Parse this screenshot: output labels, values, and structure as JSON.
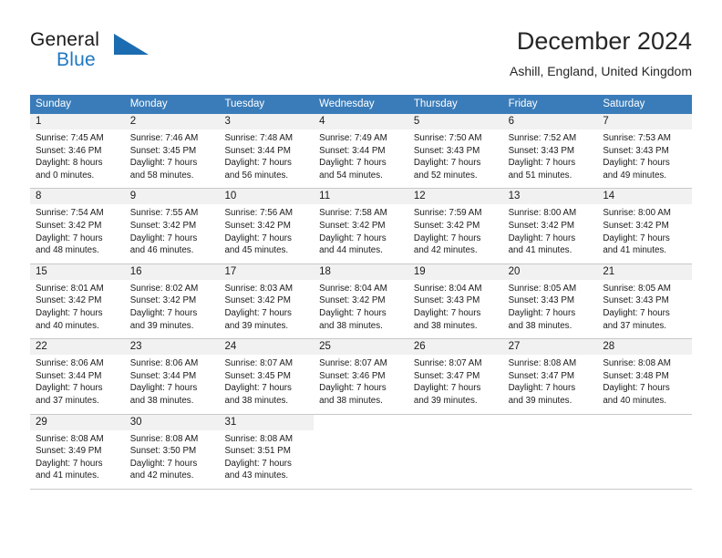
{
  "brand": {
    "name_part1": "General",
    "name_part2": "Blue",
    "mark_icon": "blue-triangle-flag-icon",
    "accent_color": "#1f78c1"
  },
  "header": {
    "title": "December 2024",
    "subtitle": "Ashill, England, United Kingdom"
  },
  "calendar": {
    "header_bg": "#3a7cb9",
    "daynum_bg": "#f1f1f1",
    "weekdays": [
      "Sunday",
      "Monday",
      "Tuesday",
      "Wednesday",
      "Thursday",
      "Friday",
      "Saturday"
    ],
    "weeks": [
      [
        {
          "day": "1",
          "sunrise": "Sunrise: 7:45 AM",
          "sunset": "Sunset: 3:46 PM",
          "daylight_line1": "Daylight: 8 hours",
          "daylight_line2": "and 0 minutes."
        },
        {
          "day": "2",
          "sunrise": "Sunrise: 7:46 AM",
          "sunset": "Sunset: 3:45 PM",
          "daylight_line1": "Daylight: 7 hours",
          "daylight_line2": "and 58 minutes."
        },
        {
          "day": "3",
          "sunrise": "Sunrise: 7:48 AM",
          "sunset": "Sunset: 3:44 PM",
          "daylight_line1": "Daylight: 7 hours",
          "daylight_line2": "and 56 minutes."
        },
        {
          "day": "4",
          "sunrise": "Sunrise: 7:49 AM",
          "sunset": "Sunset: 3:44 PM",
          "daylight_line1": "Daylight: 7 hours",
          "daylight_line2": "and 54 minutes."
        },
        {
          "day": "5",
          "sunrise": "Sunrise: 7:50 AM",
          "sunset": "Sunset: 3:43 PM",
          "daylight_line1": "Daylight: 7 hours",
          "daylight_line2": "and 52 minutes."
        },
        {
          "day": "6",
          "sunrise": "Sunrise: 7:52 AM",
          "sunset": "Sunset: 3:43 PM",
          "daylight_line1": "Daylight: 7 hours",
          "daylight_line2": "and 51 minutes."
        },
        {
          "day": "7",
          "sunrise": "Sunrise: 7:53 AM",
          "sunset": "Sunset: 3:43 PM",
          "daylight_line1": "Daylight: 7 hours",
          "daylight_line2": "and 49 minutes."
        }
      ],
      [
        {
          "day": "8",
          "sunrise": "Sunrise: 7:54 AM",
          "sunset": "Sunset: 3:42 PM",
          "daylight_line1": "Daylight: 7 hours",
          "daylight_line2": "and 48 minutes."
        },
        {
          "day": "9",
          "sunrise": "Sunrise: 7:55 AM",
          "sunset": "Sunset: 3:42 PM",
          "daylight_line1": "Daylight: 7 hours",
          "daylight_line2": "and 46 minutes."
        },
        {
          "day": "10",
          "sunrise": "Sunrise: 7:56 AM",
          "sunset": "Sunset: 3:42 PM",
          "daylight_line1": "Daylight: 7 hours",
          "daylight_line2": "and 45 minutes."
        },
        {
          "day": "11",
          "sunrise": "Sunrise: 7:58 AM",
          "sunset": "Sunset: 3:42 PM",
          "daylight_line1": "Daylight: 7 hours",
          "daylight_line2": "and 44 minutes."
        },
        {
          "day": "12",
          "sunrise": "Sunrise: 7:59 AM",
          "sunset": "Sunset: 3:42 PM",
          "daylight_line1": "Daylight: 7 hours",
          "daylight_line2": "and 42 minutes."
        },
        {
          "day": "13",
          "sunrise": "Sunrise: 8:00 AM",
          "sunset": "Sunset: 3:42 PM",
          "daylight_line1": "Daylight: 7 hours",
          "daylight_line2": "and 41 minutes."
        },
        {
          "day": "14",
          "sunrise": "Sunrise: 8:00 AM",
          "sunset": "Sunset: 3:42 PM",
          "daylight_line1": "Daylight: 7 hours",
          "daylight_line2": "and 41 minutes."
        }
      ],
      [
        {
          "day": "15",
          "sunrise": "Sunrise: 8:01 AM",
          "sunset": "Sunset: 3:42 PM",
          "daylight_line1": "Daylight: 7 hours",
          "daylight_line2": "and 40 minutes."
        },
        {
          "day": "16",
          "sunrise": "Sunrise: 8:02 AM",
          "sunset": "Sunset: 3:42 PM",
          "daylight_line1": "Daylight: 7 hours",
          "daylight_line2": "and 39 minutes."
        },
        {
          "day": "17",
          "sunrise": "Sunrise: 8:03 AM",
          "sunset": "Sunset: 3:42 PM",
          "daylight_line1": "Daylight: 7 hours",
          "daylight_line2": "and 39 minutes."
        },
        {
          "day": "18",
          "sunrise": "Sunrise: 8:04 AM",
          "sunset": "Sunset: 3:42 PM",
          "daylight_line1": "Daylight: 7 hours",
          "daylight_line2": "and 38 minutes."
        },
        {
          "day": "19",
          "sunrise": "Sunrise: 8:04 AM",
          "sunset": "Sunset: 3:43 PM",
          "daylight_line1": "Daylight: 7 hours",
          "daylight_line2": "and 38 minutes."
        },
        {
          "day": "20",
          "sunrise": "Sunrise: 8:05 AM",
          "sunset": "Sunset: 3:43 PM",
          "daylight_line1": "Daylight: 7 hours",
          "daylight_line2": "and 38 minutes."
        },
        {
          "day": "21",
          "sunrise": "Sunrise: 8:05 AM",
          "sunset": "Sunset: 3:43 PM",
          "daylight_line1": "Daylight: 7 hours",
          "daylight_line2": "and 37 minutes."
        }
      ],
      [
        {
          "day": "22",
          "sunrise": "Sunrise: 8:06 AM",
          "sunset": "Sunset: 3:44 PM",
          "daylight_line1": "Daylight: 7 hours",
          "daylight_line2": "and 37 minutes."
        },
        {
          "day": "23",
          "sunrise": "Sunrise: 8:06 AM",
          "sunset": "Sunset: 3:44 PM",
          "daylight_line1": "Daylight: 7 hours",
          "daylight_line2": "and 38 minutes."
        },
        {
          "day": "24",
          "sunrise": "Sunrise: 8:07 AM",
          "sunset": "Sunset: 3:45 PM",
          "daylight_line1": "Daylight: 7 hours",
          "daylight_line2": "and 38 minutes."
        },
        {
          "day": "25",
          "sunrise": "Sunrise: 8:07 AM",
          "sunset": "Sunset: 3:46 PM",
          "daylight_line1": "Daylight: 7 hours",
          "daylight_line2": "and 38 minutes."
        },
        {
          "day": "26",
          "sunrise": "Sunrise: 8:07 AM",
          "sunset": "Sunset: 3:47 PM",
          "daylight_line1": "Daylight: 7 hours",
          "daylight_line2": "and 39 minutes."
        },
        {
          "day": "27",
          "sunrise": "Sunrise: 8:08 AM",
          "sunset": "Sunset: 3:47 PM",
          "daylight_line1": "Daylight: 7 hours",
          "daylight_line2": "and 39 minutes."
        },
        {
          "day": "28",
          "sunrise": "Sunrise: 8:08 AM",
          "sunset": "Sunset: 3:48 PM",
          "daylight_line1": "Daylight: 7 hours",
          "daylight_line2": "and 40 minutes."
        }
      ],
      [
        {
          "day": "29",
          "sunrise": "Sunrise: 8:08 AM",
          "sunset": "Sunset: 3:49 PM",
          "daylight_line1": "Daylight: 7 hours",
          "daylight_line2": "and 41 minutes."
        },
        {
          "day": "30",
          "sunrise": "Sunrise: 8:08 AM",
          "sunset": "Sunset: 3:50 PM",
          "daylight_line1": "Daylight: 7 hours",
          "daylight_line2": "and 42 minutes."
        },
        {
          "day": "31",
          "sunrise": "Sunrise: 8:08 AM",
          "sunset": "Sunset: 3:51 PM",
          "daylight_line1": "Daylight: 7 hours",
          "daylight_line2": "and 43 minutes."
        },
        {
          "day": "",
          "sunrise": "",
          "sunset": "",
          "daylight_line1": "",
          "daylight_line2": ""
        },
        {
          "day": "",
          "sunrise": "",
          "sunset": "",
          "daylight_line1": "",
          "daylight_line2": ""
        },
        {
          "day": "",
          "sunrise": "",
          "sunset": "",
          "daylight_line1": "",
          "daylight_line2": ""
        },
        {
          "day": "",
          "sunrise": "",
          "sunset": "",
          "daylight_line1": "",
          "daylight_line2": ""
        }
      ]
    ]
  }
}
